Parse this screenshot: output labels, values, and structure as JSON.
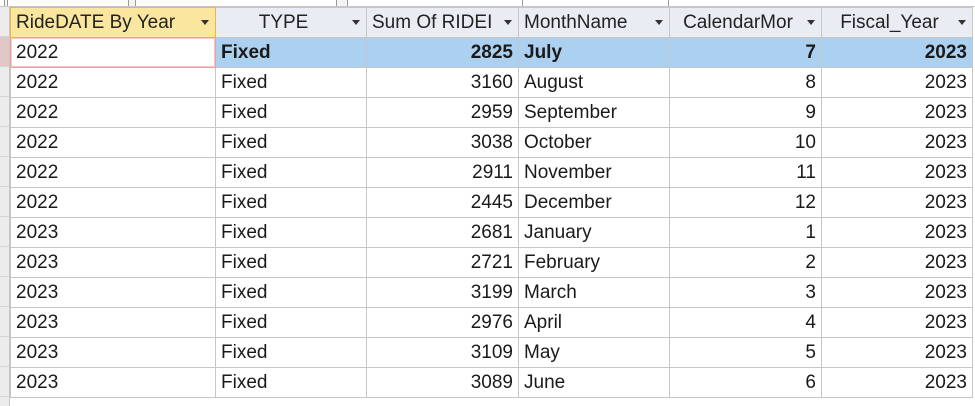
{
  "columns": [
    {
      "key": "ride_year",
      "label": "RideDATE By Year",
      "align": "left"
    },
    {
      "key": "type",
      "label": "TYPE",
      "align": "left"
    },
    {
      "key": "sum_ride",
      "label": "Sum Of RIDEI",
      "align": "right"
    },
    {
      "key": "month_name",
      "label": "MonthName",
      "align": "left"
    },
    {
      "key": "calendar_month",
      "label": "CalendarMor",
      "align": "right"
    },
    {
      "key": "fiscal_year",
      "label": "Fiscal_Year",
      "align": "right"
    }
  ],
  "rows": [
    {
      "ride_year": "2022",
      "type": "Fixed",
      "sum_ride": "2825",
      "month_name": "July",
      "calendar_month": "7",
      "fiscal_year": "2023"
    },
    {
      "ride_year": "2022",
      "type": "Fixed",
      "sum_ride": "3160",
      "month_name": "August",
      "calendar_month": "8",
      "fiscal_year": "2023"
    },
    {
      "ride_year": "2022",
      "type": "Fixed",
      "sum_ride": "2959",
      "month_name": "September",
      "calendar_month": "9",
      "fiscal_year": "2023"
    },
    {
      "ride_year": "2022",
      "type": "Fixed",
      "sum_ride": "3038",
      "month_name": "October",
      "calendar_month": "10",
      "fiscal_year": "2023"
    },
    {
      "ride_year": "2022",
      "type": "Fixed",
      "sum_ride": "2911",
      "month_name": "November",
      "calendar_month": "11",
      "fiscal_year": "2023"
    },
    {
      "ride_year": "2022",
      "type": "Fixed",
      "sum_ride": "2445",
      "month_name": "December",
      "calendar_month": "12",
      "fiscal_year": "2023"
    },
    {
      "ride_year": "2023",
      "type": "Fixed",
      "sum_ride": "2681",
      "month_name": "January",
      "calendar_month": "1",
      "fiscal_year": "2023"
    },
    {
      "ride_year": "2023",
      "type": "Fixed",
      "sum_ride": "2721",
      "month_name": "February",
      "calendar_month": "2",
      "fiscal_year": "2023"
    },
    {
      "ride_year": "2023",
      "type": "Fixed",
      "sum_ride": "3199",
      "month_name": "March",
      "calendar_month": "3",
      "fiscal_year": "2023"
    },
    {
      "ride_year": "2023",
      "type": "Fixed",
      "sum_ride": "2976",
      "month_name": "April",
      "calendar_month": "4",
      "fiscal_year": "2023"
    },
    {
      "ride_year": "2023",
      "type": "Fixed",
      "sum_ride": "3109",
      "month_name": "May",
      "calendar_month": "5",
      "fiscal_year": "2023"
    },
    {
      "ride_year": "2023",
      "type": "Fixed",
      "sum_ride": "3089",
      "month_name": "June",
      "calendar_month": "6",
      "fiscal_year": "2023"
    }
  ],
  "selected_row": 0,
  "colors": {
    "header_bg": "#e9edf3",
    "active_header_bg": "#fbe6a0",
    "selected_row_bg": "#acd0ef"
  },
  "icons": {
    "sort": "dropdown-arrow-icon"
  }
}
